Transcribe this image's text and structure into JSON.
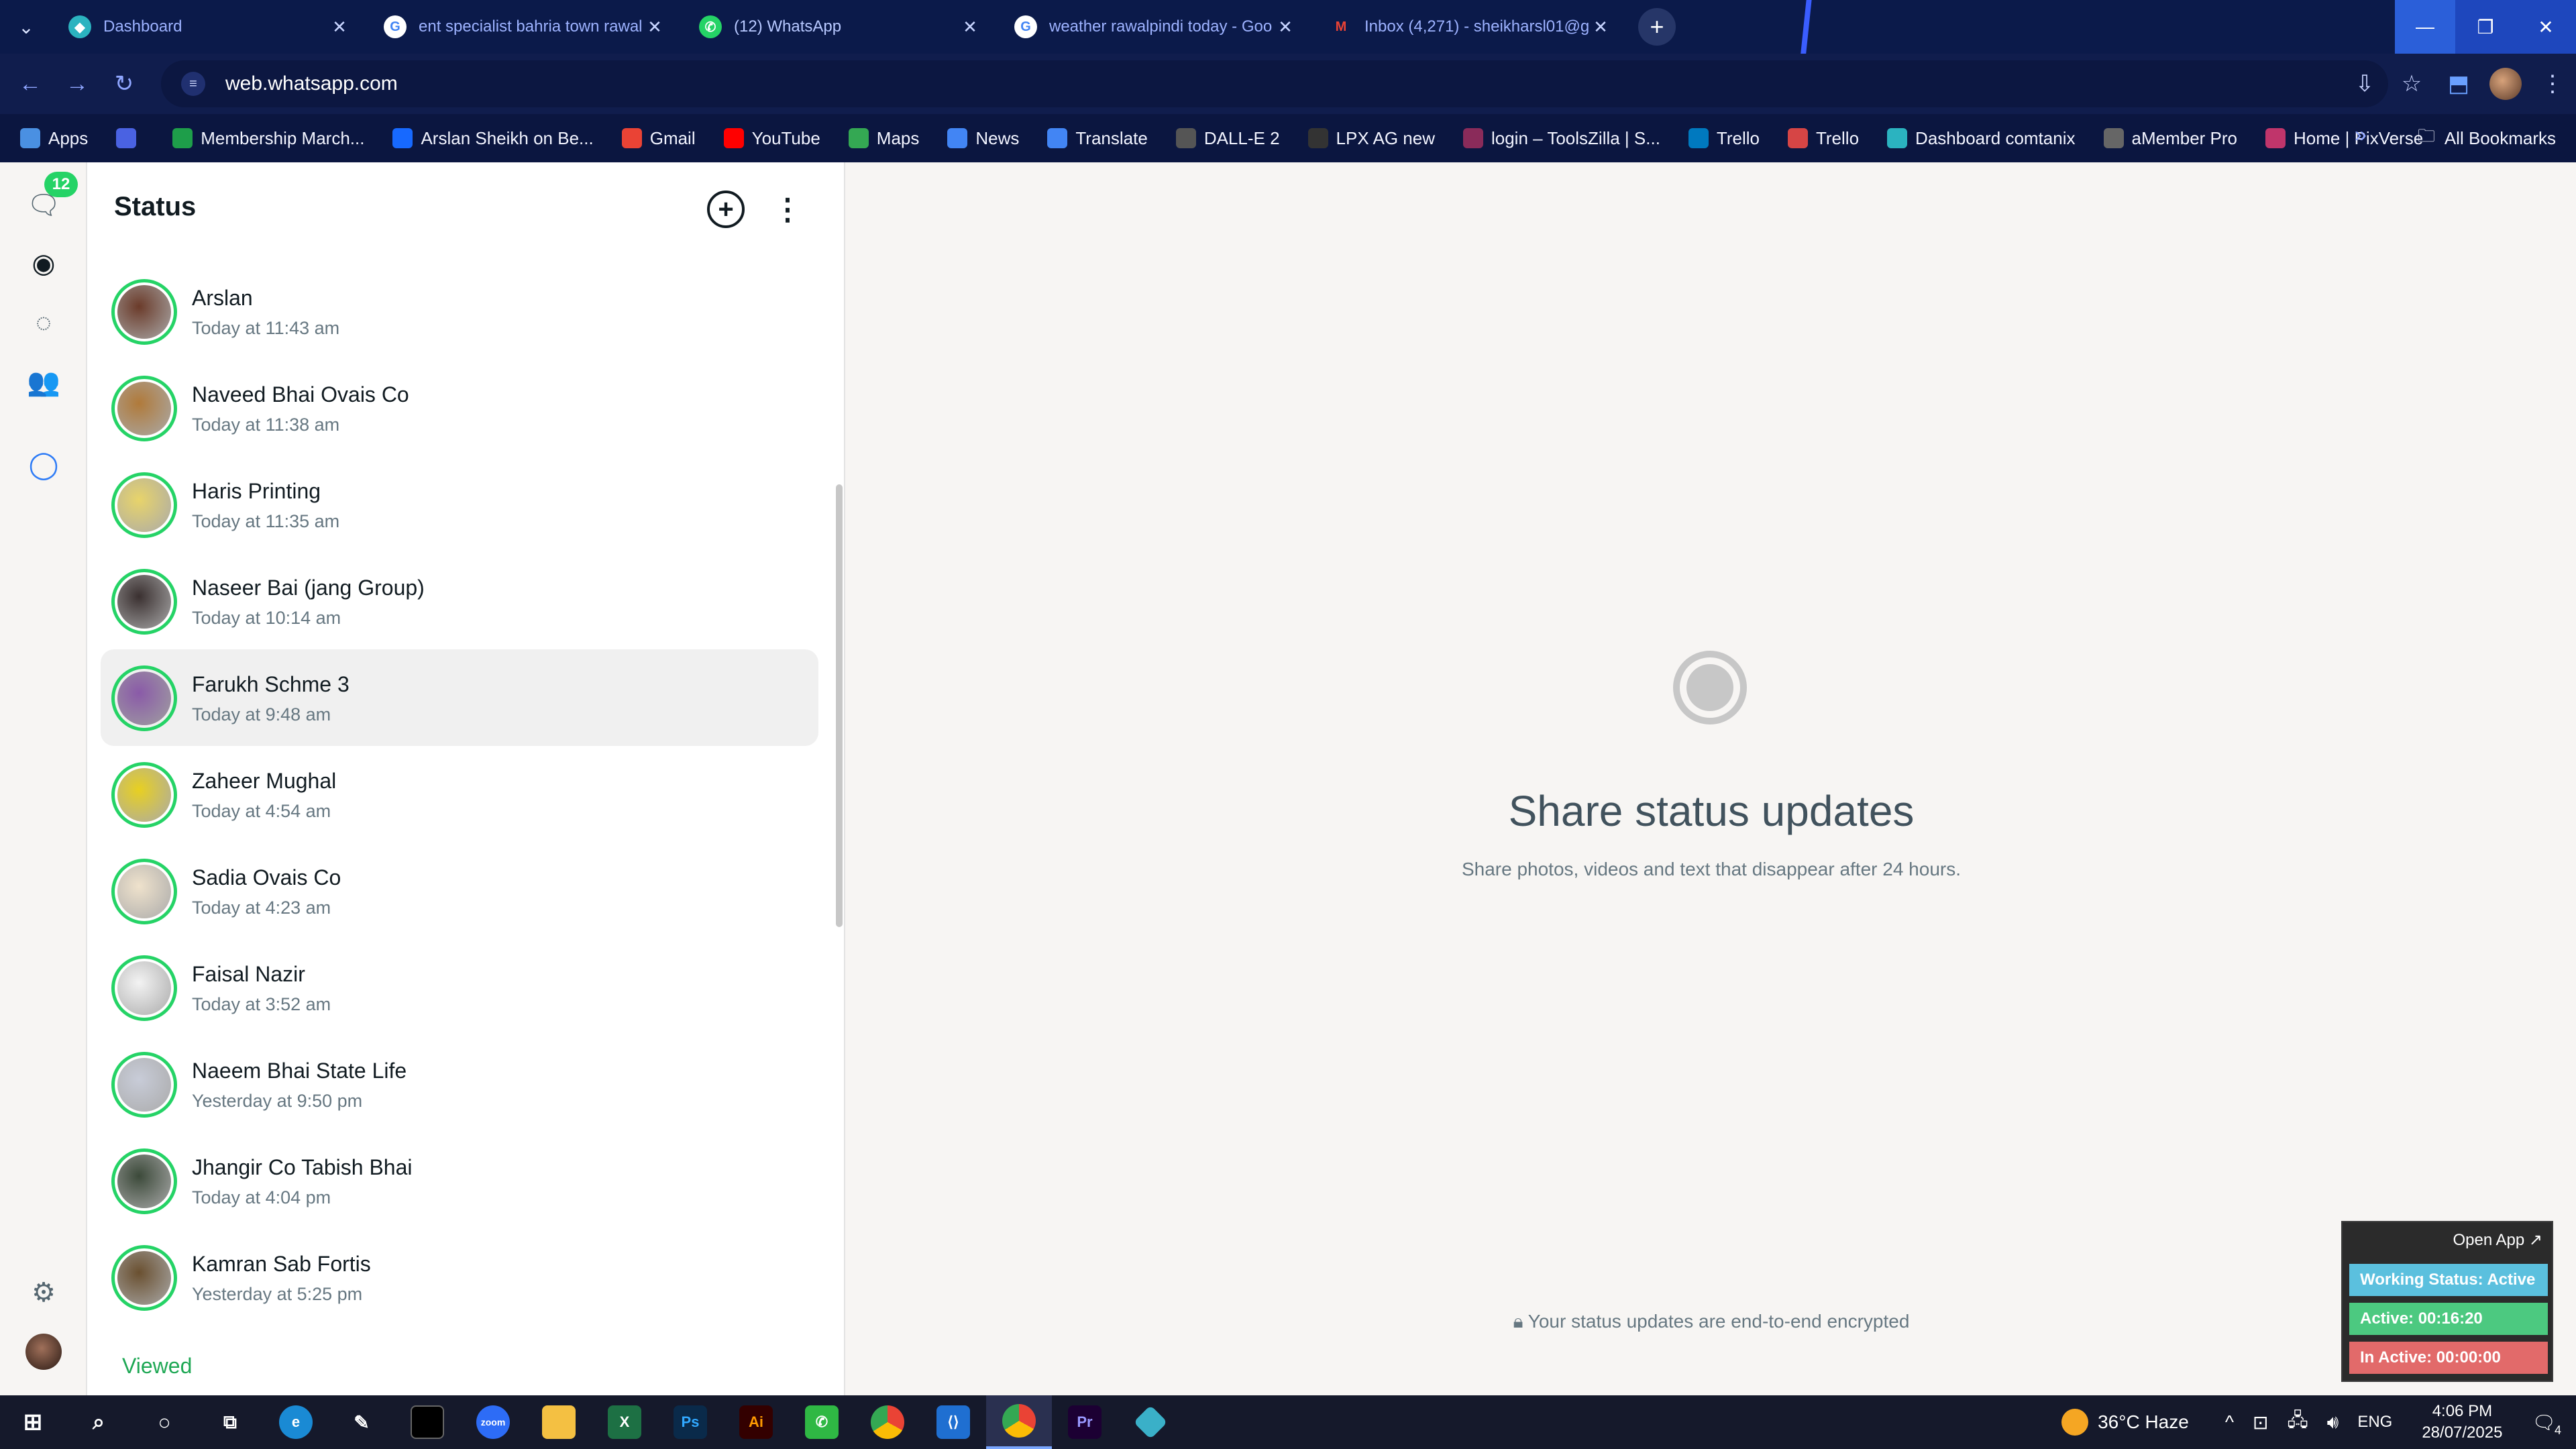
{
  "browser": {
    "tabs": [
      {
        "title": "Dashboard",
        "icon": "wp-icon",
        "active": false
      },
      {
        "title": "ent specialist bahria town rawal",
        "icon": "google-icon",
        "active": false
      },
      {
        "title": "(12) WhatsApp",
        "icon": "whatsapp-icon",
        "active": true
      },
      {
        "title": "weather rawalpindi today - Goo",
        "icon": "google-icon",
        "active": false
      },
      {
        "title": "Inbox (4,271) - sheikharsl01@g",
        "icon": "gmail-icon",
        "active": false
      }
    ],
    "new_tab_label": "+",
    "url": "web.whatsapp.com",
    "bookmarks": [
      {
        "label": "Apps",
        "color": "#4a90e2"
      },
      {
        "label": "",
        "color": "#4a62e2"
      },
      {
        "label": "Membership March...",
        "color": "#1e9e4a"
      },
      {
        "label": "Arslan Sheikh on Be...",
        "color": "#1769ff"
      },
      {
        "label": "Gmail",
        "color": "#ea4335"
      },
      {
        "label": "YouTube",
        "color": "#ff0000"
      },
      {
        "label": "Maps",
        "color": "#34a853"
      },
      {
        "label": "News",
        "color": "#4285f4"
      },
      {
        "label": "Translate",
        "color": "#4285f4"
      },
      {
        "label": "DALL-E 2",
        "color": "#555555"
      },
      {
        "label": "LPX AG new",
        "color": "#333333"
      },
      {
        "label": "login – ToolsZilla | S...",
        "color": "#8a2b5a"
      },
      {
        "label": "Trello",
        "color": "#0079bf"
      },
      {
        "label": "Trello",
        "color": "#d64545"
      },
      {
        "label": "Dashboard comtanix",
        "color": "#2bb3c0"
      },
      {
        "label": "aMember Pro",
        "color": "#666666"
      },
      {
        "label": "Home | PixVerse",
        "color": "#c0356b"
      }
    ],
    "more_label": "»",
    "all_bookmarks_label": "All Bookmarks"
  },
  "whatsapp": {
    "unread_badge": "12",
    "panel_title": "Status",
    "statuses": [
      {
        "name": "Arslan",
        "time": "Today at 11:43 am",
        "avatar_color": "#6b3b2a"
      },
      {
        "name": "Naveed Bhai Ovais Co",
        "time": "Today at 11:38 am",
        "avatar_color": "#b07a3a"
      },
      {
        "name": "Haris Printing",
        "time": "Today at 11:35 am",
        "avatar_color": "#e8d46a"
      },
      {
        "name": "Naseer Bai (jang Group)",
        "time": "Today at 10:14 am",
        "avatar_color": "#3a3030"
      },
      {
        "name": "Farukh Schme 3",
        "time": "Today at 9:48 am",
        "avatar_color": "#8a5aa8"
      },
      {
        "name": "Zaheer Mughal",
        "time": "Today at 4:54 am",
        "avatar_color": "#e8d020"
      },
      {
        "name": "Sadia Ovais Co",
        "time": "Today at 4:23 am",
        "avatar_color": "#efe2cc"
      },
      {
        "name": "Faisal Nazir",
        "time": "Today at 3:52 am",
        "avatar_color": "#f3f3f3"
      },
      {
        "name": "Naeem Bhai State Life",
        "time": "Yesterday at 9:50 pm",
        "avatar_color": "#c8ccd8"
      },
      {
        "name": "Jhangir Co Tabish Bhai",
        "time": "Today at 4:04 pm",
        "avatar_color": "#3c4a3a"
      },
      {
        "name": "Kamran Sab Fortis",
        "time": "Yesterday at 5:25 pm",
        "avatar_color": "#6a5030"
      }
    ],
    "viewed_label": "Viewed",
    "main_title": "Share status updates",
    "main_subtitle": "Share photos, videos and text that disappear after 24 hours.",
    "encrypted_note": "Your status updates are end-to-end encrypted"
  },
  "widget": {
    "open_app": "Open App ↗",
    "working_status": "Working Status: Active",
    "active": "Active: 00:16:20",
    "inactive": "In Active: 00:00:00"
  },
  "taskbar": {
    "weather": "36°C  Haze",
    "language": "ENG",
    "time": "4:06 PM",
    "date": "28/07/2025",
    "notification_count": "4"
  }
}
